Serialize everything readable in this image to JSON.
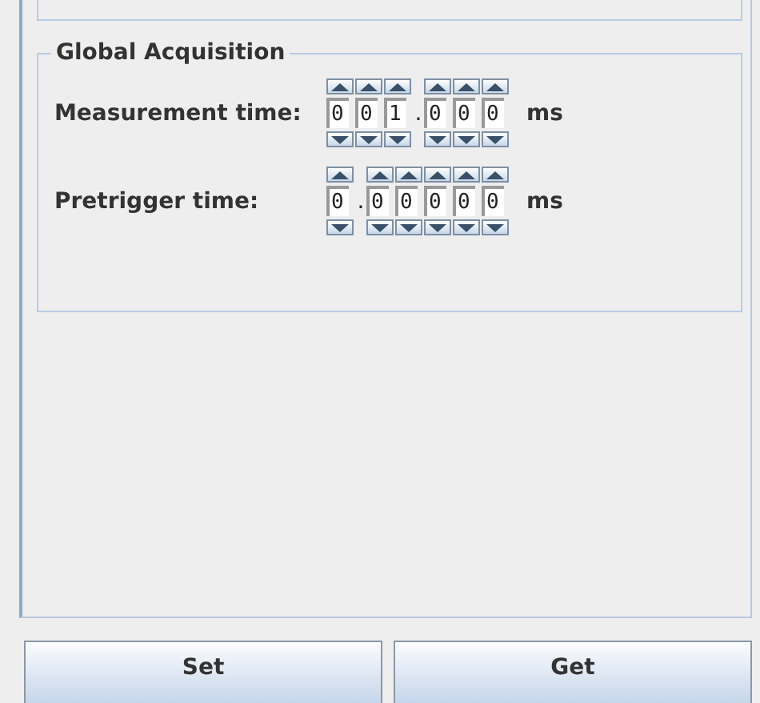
{
  "group": {
    "title": "Global Acquisition"
  },
  "rows": [
    {
      "label": "Measurement time:",
      "unit": "ms",
      "cells": [
        {
          "kind": "digit",
          "value": "0"
        },
        {
          "kind": "digit",
          "value": "0"
        },
        {
          "kind": "digit",
          "value": "1"
        },
        {
          "kind": "separator",
          "value": "."
        },
        {
          "kind": "digit",
          "value": "0"
        },
        {
          "kind": "digit",
          "value": "0"
        },
        {
          "kind": "digit",
          "value": "0"
        }
      ]
    },
    {
      "label": "Pretrigger time:",
      "unit": "ms",
      "cells": [
        {
          "kind": "digit",
          "value": "0"
        },
        {
          "kind": "separator",
          "value": "."
        },
        {
          "kind": "digit",
          "value": "0"
        },
        {
          "kind": "digit",
          "value": "0"
        },
        {
          "kind": "digit",
          "value": "0"
        },
        {
          "kind": "digit",
          "value": "0"
        },
        {
          "kind": "digit",
          "value": "0"
        }
      ]
    }
  ],
  "buttons": [
    {
      "label": "Set"
    },
    {
      "label": "Get"
    }
  ]
}
